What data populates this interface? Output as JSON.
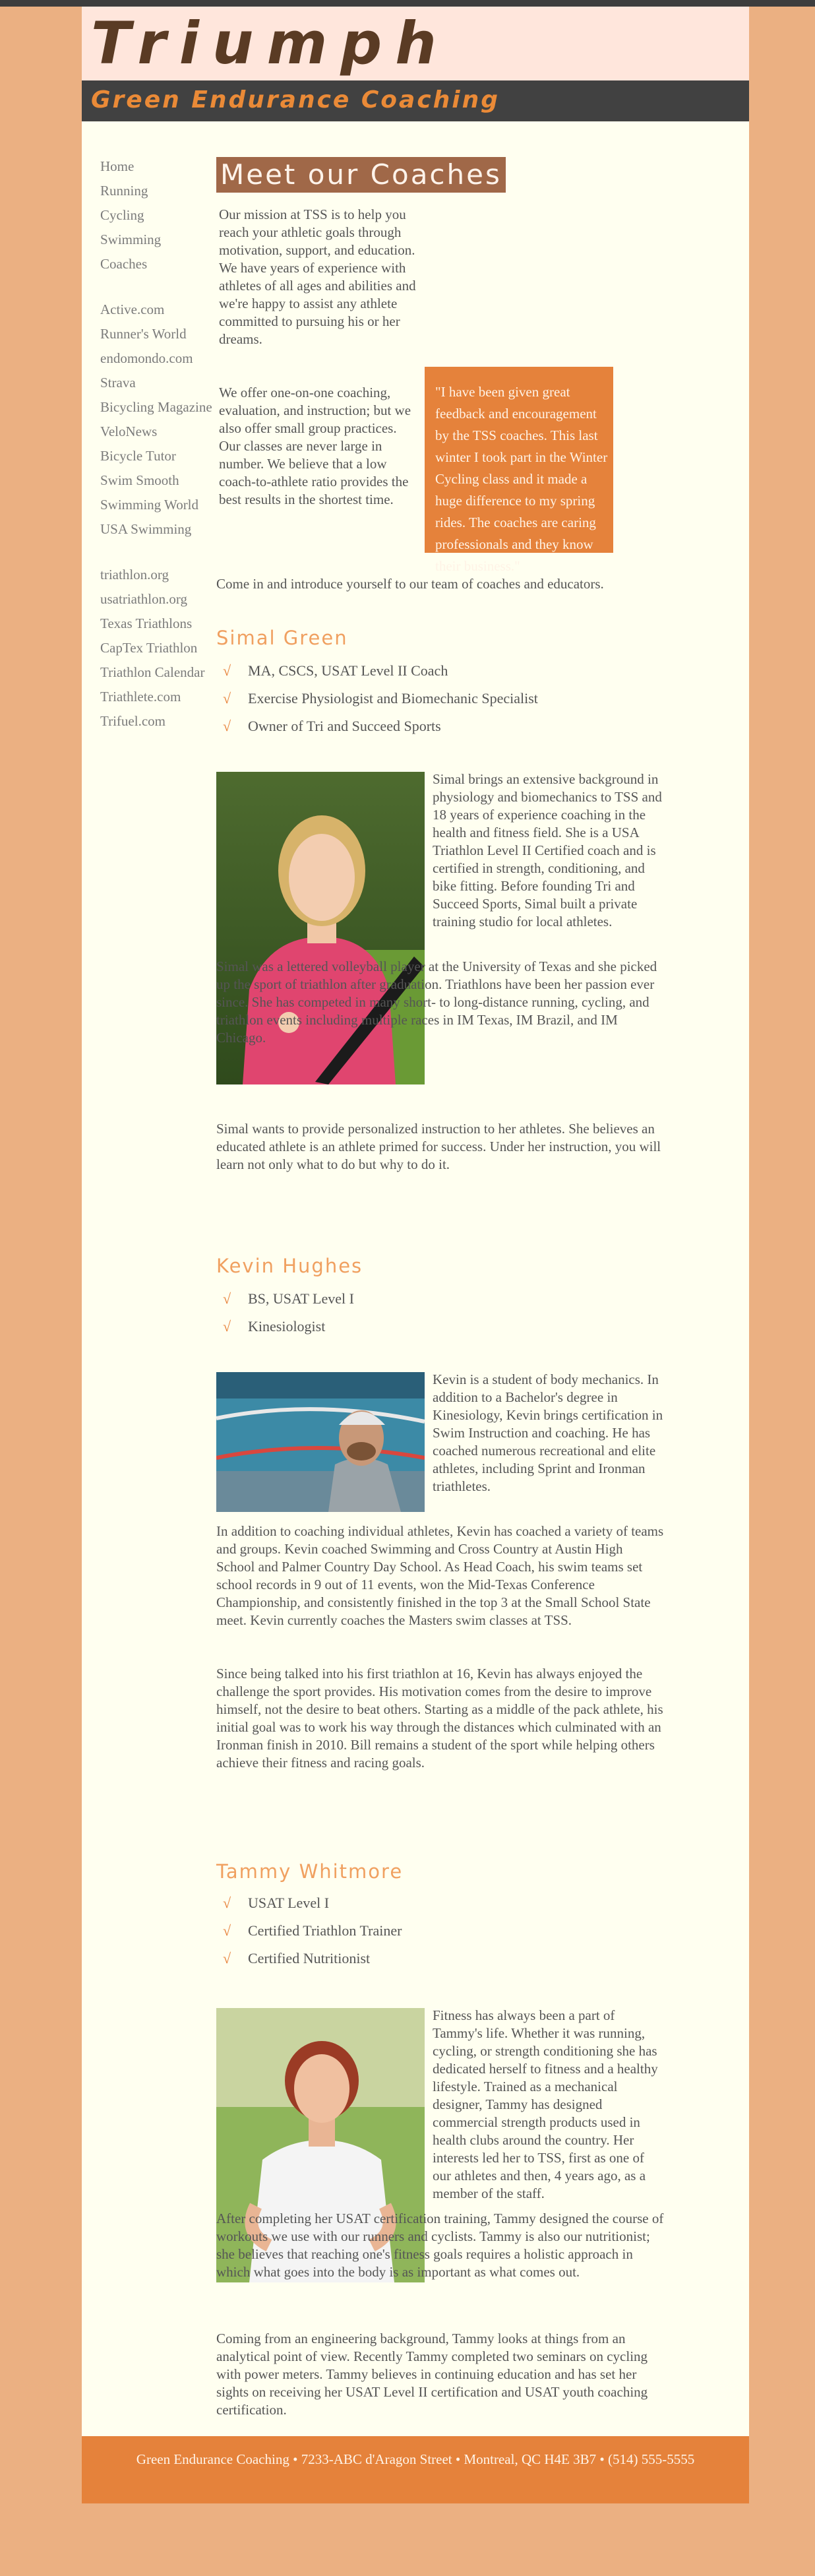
{
  "site": {
    "name": "Triumph",
    "tagline": "Green Endurance Coaching"
  },
  "nav": {
    "primary": [
      "Home",
      "Running",
      "Cycling",
      "Swimming",
      "Coaches"
    ],
    "links1": [
      "Active.com",
      "Runner's World",
      "endomondo.com",
      "Strava",
      "Bicycling Magazine",
      "VeloNews",
      "Bicycle Tutor",
      "Swim Smooth",
      "Swimming World",
      "USA Swimming"
    ],
    "links2": [
      "triathlon.org",
      "usatriathlon.org",
      "Texas Triathlons",
      "CapTex Triathlon",
      "Triathlon Calendar",
      "Triathlete.com",
      "Trifuel.com"
    ]
  },
  "main": {
    "title": "Meet our Coaches",
    "intro1": "Our mission at TSS is to help you reach your athletic goals through motivation, support, and education. We have years of experience with athletes of all ages and abilities and we're happy to assist any athlete committed to pursuing his or her dreams.",
    "intro2": "We offer one-on-one coaching, evaluation, and instruction; but we also offer small group practices. Our classes are never large in number. We believe that a low coach-to-athlete ratio provides the best results in the shortest time.",
    "quote": "\"I have been given great feedback and encouragement by the TSS coaches. This last winter I took part in the Winter Cycling class and it made a huge difference to my spring rides. The coaches are caring professionals and they know their business.\"",
    "invite": "Come in and introduce yourself to our team of coaches and educators."
  },
  "check_glyph": "√",
  "coaches": [
    {
      "name": "Simal Green",
      "credentials": [
        "MA, CSCS, USAT Level II Coach",
        "Exercise Physiologist and Biomechanic Specialist",
        "Owner of Tri and Succeed Sports"
      ],
      "para1": "Simal brings an extensive background in physiology and biomechanics to TSS and 18 years of experience coaching in the health and fitness field. She is a USA Triathlon Level II Certified coach and is certified in strength, conditioning, and bike fitting. Before founding Tri and Succeed Sports, Simal built a private training studio for local athletes.",
      "para2": "Simal was a lettered volleyball player at the University of Texas and she picked up the sport of triathlon after graduation. Triathlons have been her passion ever since. She has competed in many short- to long-distance running, cycling, and triathlon events including multiple races in IM Texas, IM Brazil, and IM Chicago.",
      "para3": "Simal wants to provide personalized instruction to her athletes. She believes an educated athlete is an athlete primed for success. Under her instruction, you will learn not only what to do but why to do it."
    },
    {
      "name": "Kevin Hughes",
      "credentials": [
        "BS, USAT Level I",
        "Kinesiologist"
      ],
      "para1": "Kevin is a student of body mechanics. In addition to a Bachelor's degree in Kinesiology, Kevin brings certification in Swim Instruction and coaching. He has coached numerous recreational and elite athletes, including Sprint and Ironman triathletes.",
      "para2": "In addition to coaching individual athletes, Kevin has coached a variety of teams and groups. Kevin coached Swimming and Cross Country at Austin High School and Palmer Country Day School. As Head Coach, his swim teams set school records in 9 out of 11 events, won the Mid-Texas Conference Championship, and consistently finished in the top 3 at the Small School State meet. Kevin currently coaches the Masters swim classes at TSS.",
      "para3": "Since being talked into his first triathlon at 16, Kevin has always enjoyed the challenge the sport provides. His motivation comes from the desire to improve himself, not the desire to beat others. Starting as a middle of the pack athlete, his initial goal was to work his way through the distances which culminated with an Ironman finish in 2010. Bill remains a student of the sport while helping others achieve their fitness and racing goals."
    },
    {
      "name": "Tammy Whitmore",
      "credentials": [
        "USAT Level I",
        "Certified Triathlon Trainer",
        "Certified Nutritionist"
      ],
      "para1": "Fitness has always been a part of Tammy's life. Whether it was running, cycling, or strength conditioning she has dedicated herself to fitness and a healthy lifestyle. Trained as a mechanical designer, Tammy has designed commercial strength products used in health clubs around the country. Her interests led her to TSS, first as one of our athletes and then, 4 years ago, as a member of the staff.",
      "para2": "After completing her USAT certification training, Tammy designed the course of workouts we use with our runners and cyclists. Tammy is also our nutritionist; she believes that reaching one's fitness goals requires a holistic approach in which what goes into the body is as important as what comes out.",
      "para3": "Coming from an engineering background, Tammy looks at things from an analytical point of view. Recently Tammy completed two seminars on cycling with power meters. Tammy believes in continuing education and has set her sights on receiving her USAT Level II certification and USAT youth coaching certification."
    }
  ],
  "footer": {
    "text": "Green Endurance Coaching • 7233-ABC d'Aragon Street • Montreal, QC H4E 3B7 • (514) 555-5555"
  },
  "colors": {
    "page_bg": "#ebb082",
    "content_bg": "#fffff0",
    "accent": "#e5823b",
    "brand_text": "#5a3b24",
    "coach_name": "#f0a060"
  }
}
